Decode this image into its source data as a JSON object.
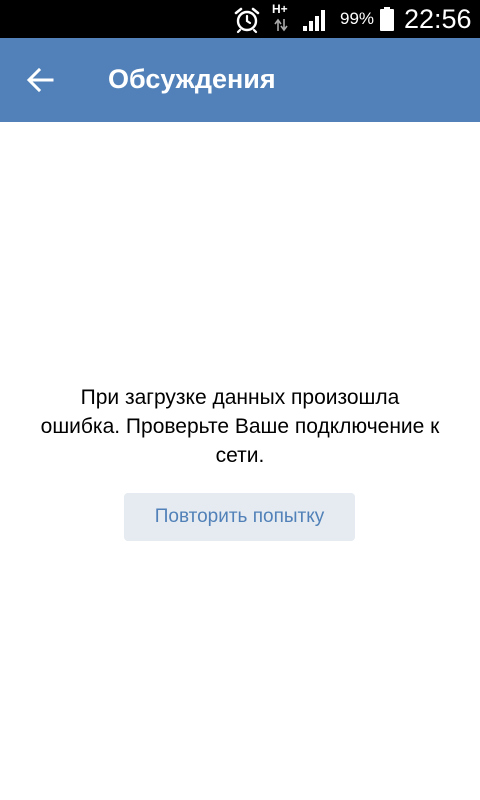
{
  "status_bar": {
    "network_type": "H+",
    "battery_percent": "99%",
    "time": "22:56",
    "icons": [
      "alarm-icon",
      "network-arrows-icon",
      "signal-icon",
      "battery-icon"
    ]
  },
  "header": {
    "title": "Обсуждения",
    "back_icon": "arrow-left-icon"
  },
  "error": {
    "message": "При загрузке данных произошла ошибка. Проверьте Ваше подключение к сети.",
    "retry_label": "Повторить попытку"
  },
  "colors": {
    "header_bg": "#5181b8",
    "retry_bg": "#e5ebf1",
    "retry_text": "#5181b8"
  }
}
